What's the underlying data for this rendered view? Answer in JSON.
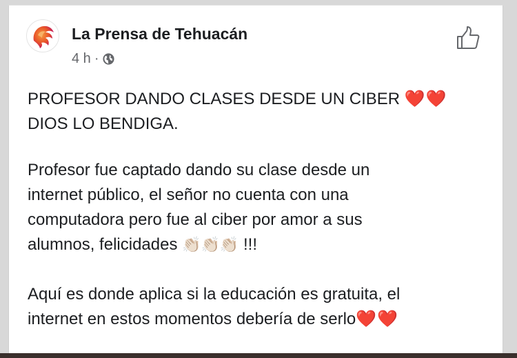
{
  "post": {
    "page_name": "La Prensa de Tehuacán",
    "timestamp": "4 h",
    "separator": "·",
    "privacy_icon": "globe-icon",
    "like_icon": "thumbs-up-icon",
    "avatar_icon": "lion-logo-icon",
    "paragraph1": {
      "line1": "PROFESOR DANDO CLASES DESDE UN CIBER",
      "line1_emoji": "❤️❤️",
      "line2": "DIOS LO BENDIGA."
    },
    "paragraph2": {
      "line1": "Profesor fue captado dando su clase desde un",
      "line2": "internet público, el señor no cuenta con una",
      "line3": "computadora pero fue al ciber por amor a sus",
      "line4": "alumnos, felicidades",
      "line4_emoji": "👏🏻👏🏻👏🏻",
      "line4_end": "!!!"
    },
    "paragraph3": {
      "line1": "Aquí es donde aplica si la educación es gratuita, el",
      "line2": "internet en estos momentos debería de serlo",
      "line2_emoji": "❤️❤️"
    }
  },
  "colors": {
    "name_text": "#1c1e21",
    "meta_text": "#65676b",
    "heart": "#d0021b",
    "avatar_accent": "#e8542a"
  }
}
